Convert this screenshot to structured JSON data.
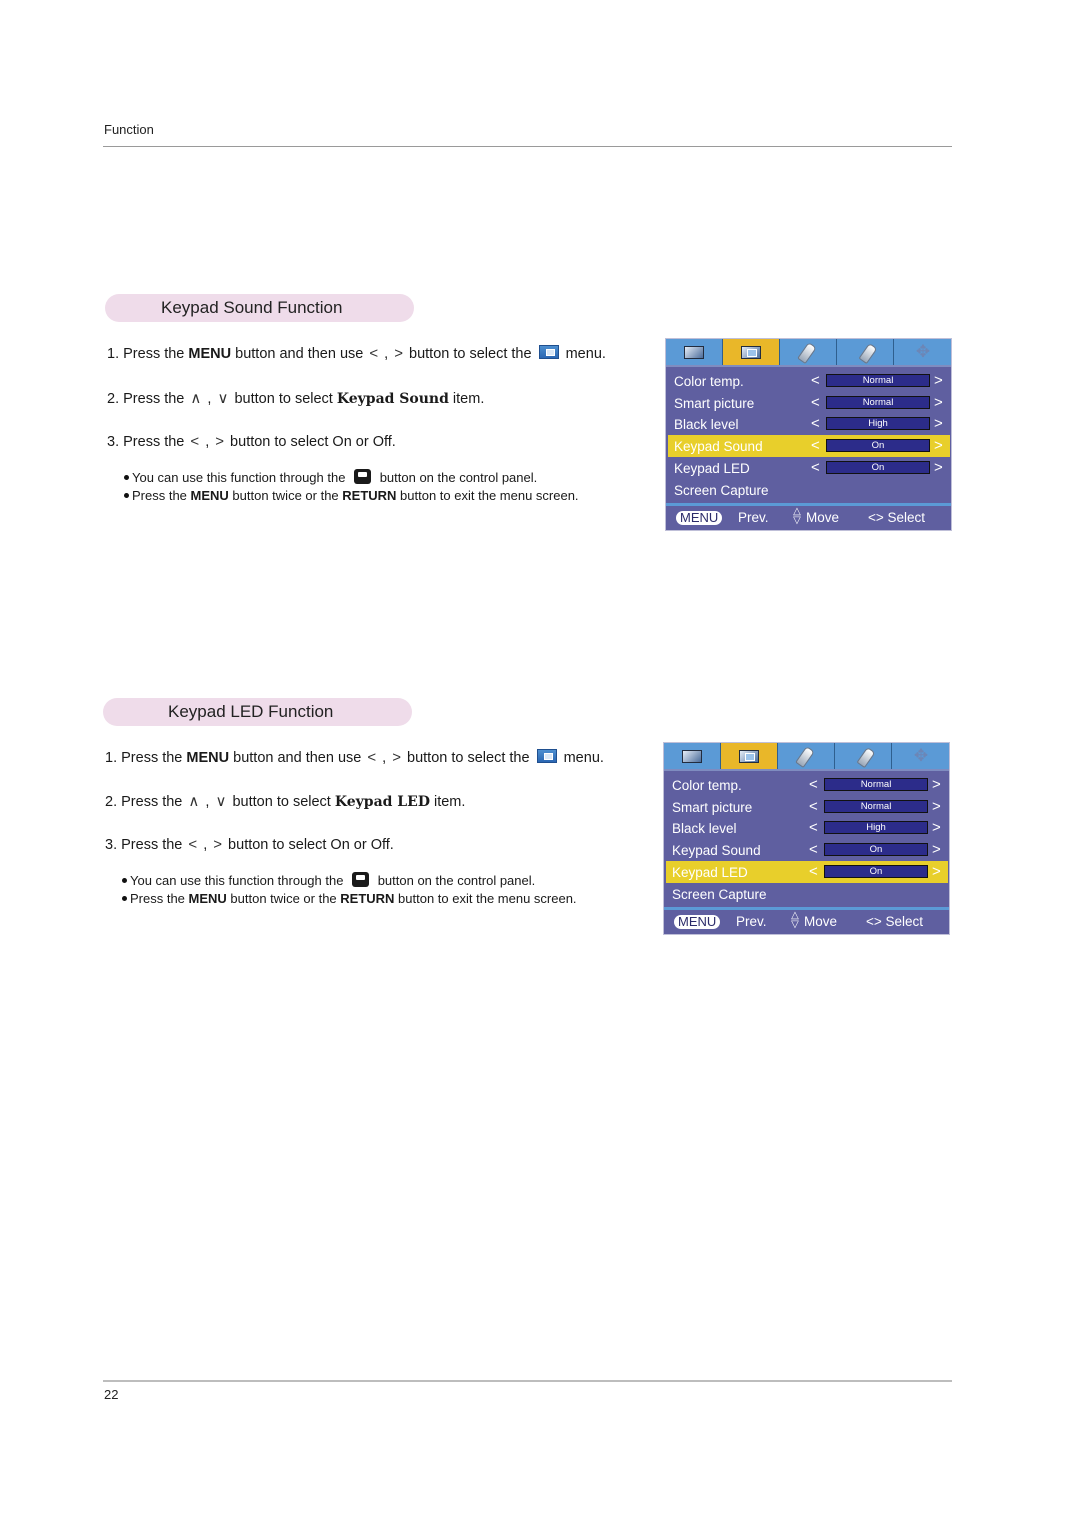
{
  "page": {
    "running_header": "Function",
    "page_number": "22"
  },
  "sections": [
    {
      "title": "Keypad Sound Function",
      "steps": [
        {
          "num": "1.",
          "pre": "Press the ",
          "bold": "MENU",
          "mid": " button and then use ",
          "arrow_a": "<",
          "sep": " , ",
          "arrow_b": ">",
          "post": " button to select the ",
          "icon": "picture-menu-icon",
          "end": " menu."
        },
        {
          "num": "2.",
          "pre": "Press the ",
          "arrow_a": "∧",
          "sep": " , ",
          "arrow_b": "∨",
          "mid": " button to select ",
          "slab": "Keypad Sound",
          "end": " item."
        },
        {
          "num": "3.",
          "pre": "Press the ",
          "arrow_a": "<",
          "sep": " , ",
          "arrow_b": ">",
          "end": " button to select On or Off."
        }
      ],
      "notes": [
        {
          "pre": "You can use this function through the ",
          "icon": "control-panel-button-icon",
          "end": " button on the control panel."
        },
        {
          "pre": "Press the ",
          "bold1": "MENU",
          "mid": " button twice or the ",
          "bold2": "RETURN",
          "end": " button to exit the menu screen."
        }
      ],
      "osd": {
        "tabs": [
          "screen-tab-icon",
          "picture-tab-icon",
          "tag-tab-icon",
          "tags-tab-icon",
          "move-tab-icon"
        ],
        "active_tab": 1,
        "rows": [
          {
            "label": "Color temp.",
            "value": "Normal"
          },
          {
            "label": "Smart picture",
            "value": "Normal"
          },
          {
            "label": "Black level",
            "value": "High"
          },
          {
            "label": "Keypad Sound",
            "value": "On",
            "selected": true
          },
          {
            "label": "Keypad LED",
            "value": "On"
          },
          {
            "label": "Screen Capture"
          }
        ],
        "footer": {
          "menu": "MENU",
          "prev": "Prev.",
          "move": "Move",
          "select": "<> Select"
        }
      }
    },
    {
      "title": "Keypad LED Function",
      "steps": [
        {
          "num": "1.",
          "pre": "Press the ",
          "bold": "MENU",
          "mid": " button and then use ",
          "arrow_a": "<",
          "sep": " , ",
          "arrow_b": ">",
          "post": " button to select the ",
          "icon": "picture-menu-icon",
          "end": " menu."
        },
        {
          "num": "2.",
          "pre": "Press the ",
          "arrow_a": "∧",
          "sep": " , ",
          "arrow_b": "∨",
          "mid": " button to select ",
          "slab": "Keypad LED",
          "end": " item."
        },
        {
          "num": "3.",
          "pre": "Press the ",
          "arrow_a": "<",
          "sep": " , ",
          "arrow_b": ">",
          "end": " button to select On or Off."
        }
      ],
      "notes": [
        {
          "pre": "You can use this function through the ",
          "icon": "control-panel-button-icon",
          "end": " button on the control panel."
        },
        {
          "pre": "Press the ",
          "bold1": "MENU",
          "mid": " button twice or the ",
          "bold2": "RETURN",
          "end": " button to exit the menu screen."
        }
      ],
      "osd": {
        "tabs": [
          "screen-tab-icon",
          "picture-tab-icon",
          "tag-tab-icon",
          "tags-tab-icon",
          "move-tab-icon"
        ],
        "active_tab": 1,
        "rows": [
          {
            "label": "Color temp.",
            "value": "Normal"
          },
          {
            "label": "Smart picture",
            "value": "Normal"
          },
          {
            "label": "Black level",
            "value": "High"
          },
          {
            "label": "Keypad Sound",
            "value": "On"
          },
          {
            "label": "Keypad LED",
            "value": "On",
            "selected": true
          },
          {
            "label": "Screen Capture"
          }
        ],
        "footer": {
          "menu": "MENU",
          "prev": "Prev.",
          "move": "Move",
          "select": "<> Select"
        }
      }
    }
  ]
}
